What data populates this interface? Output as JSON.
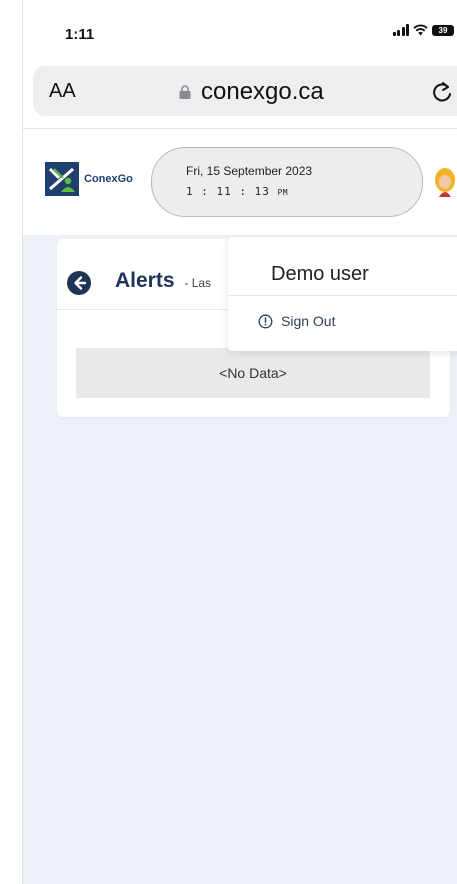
{
  "status_bar": {
    "time": "1:11",
    "battery": "39"
  },
  "browser": {
    "aa_label": "AA",
    "url": "conexgo.ca"
  },
  "header": {
    "brand": "ConexGo",
    "date": "Fri, 15 September 2023",
    "time": "1 : 11 : 13",
    "ampm": "PM"
  },
  "page": {
    "title": "Alerts",
    "subtitle": "- Las",
    "no_data": "<No Data>"
  },
  "dropdown": {
    "user_name": "Demo user",
    "sign_out": "Sign Out"
  },
  "colors": {
    "brand_navy": "#1f3f6e",
    "brand_green": "#5cbc3b",
    "title": "#1f3556"
  },
  "icons": [
    "lock-icon",
    "reload-icon",
    "back-arrow-icon",
    "sign-out-icon",
    "avatar",
    "signal-icon",
    "wifi-icon",
    "battery-icon"
  ]
}
